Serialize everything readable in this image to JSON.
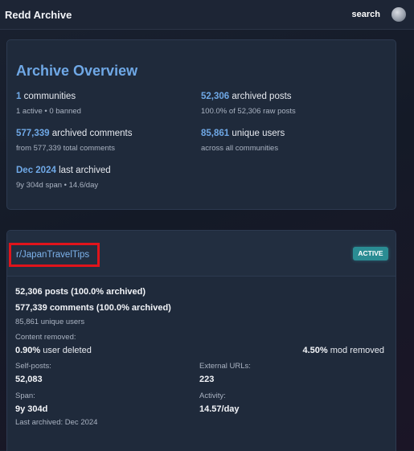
{
  "header": {
    "brand": "Redd Archive",
    "search": "search"
  },
  "overview": {
    "title": "Archive Overview",
    "communities": {
      "num": "1",
      "label": "communities",
      "sub": "1 active • 0 banned"
    },
    "posts": {
      "num": "52,306",
      "label": "archived posts",
      "sub": "100.0% of 52,306 raw posts"
    },
    "comments": {
      "num": "577,339",
      "label": "archived comments",
      "sub": "from 577,339 total comments"
    },
    "users": {
      "num": "85,861",
      "label": "unique users",
      "sub": "across all communities"
    },
    "last": {
      "num": "Dec 2024",
      "label": "last archived",
      "sub": "9y 304d span • 14.6/day"
    }
  },
  "community": {
    "name": "r/JapanTravelTips",
    "status": "ACTIVE",
    "posts_line": "52,306 posts (100.0% archived)",
    "comments_line": "577,339 comments (100.0% archived)",
    "users_line": "85,861 unique users",
    "content_removed_label": "Content removed:",
    "user_deleted_pct": "0.90%",
    "user_deleted_label": "user deleted",
    "mod_removed_pct": "4.50%",
    "mod_removed_label": "mod removed",
    "self_posts_label": "Self-posts:",
    "self_posts_value": "52,083",
    "external_label": "External URLs:",
    "external_value": "223",
    "span_label": "Span:",
    "span_value": "9y 304d",
    "activity_label": "Activity:",
    "activity_value": "14.57/day",
    "last_archived": "Last archived: Dec 2024"
  }
}
